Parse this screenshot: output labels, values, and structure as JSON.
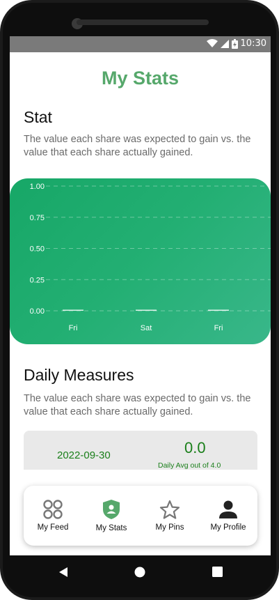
{
  "status": {
    "time": "10:30"
  },
  "page": {
    "title": "My Stats"
  },
  "stat_section": {
    "title": "Stat",
    "description": "The value each share was expected to gain vs. the value that each share actually gained."
  },
  "chart_data": {
    "type": "bar",
    "categories": [
      "Fri",
      "Sat",
      "Fri"
    ],
    "values": [
      0,
      0,
      0
    ],
    "y_ticks": [
      "1.00",
      "0.75",
      "0.50",
      "0.25",
      "0.00"
    ],
    "ylim": [
      0,
      1
    ],
    "grid": true
  },
  "daily_section": {
    "title": "Daily Measures",
    "description": "The value each share was expected to gain vs. the value that each share actually gained."
  },
  "measure": {
    "date": "2022-09-30",
    "value": "0.0",
    "subtitle": "Daily Avg out of 4.0"
  },
  "nav": {
    "items": [
      {
        "label": "My Feed",
        "icon": "grid-circles-icon"
      },
      {
        "label": "My Stats",
        "icon": "shield-person-icon",
        "active": true
      },
      {
        "label": "My Pins",
        "icon": "star-outline-icon"
      },
      {
        "label": "My Profile",
        "icon": "person-icon"
      }
    ]
  },
  "colors": {
    "accent": "#56a86b",
    "chart_top": "#17a767",
    "chart_bottom": "#39b78a",
    "measure_text": "#1a7f1a"
  }
}
